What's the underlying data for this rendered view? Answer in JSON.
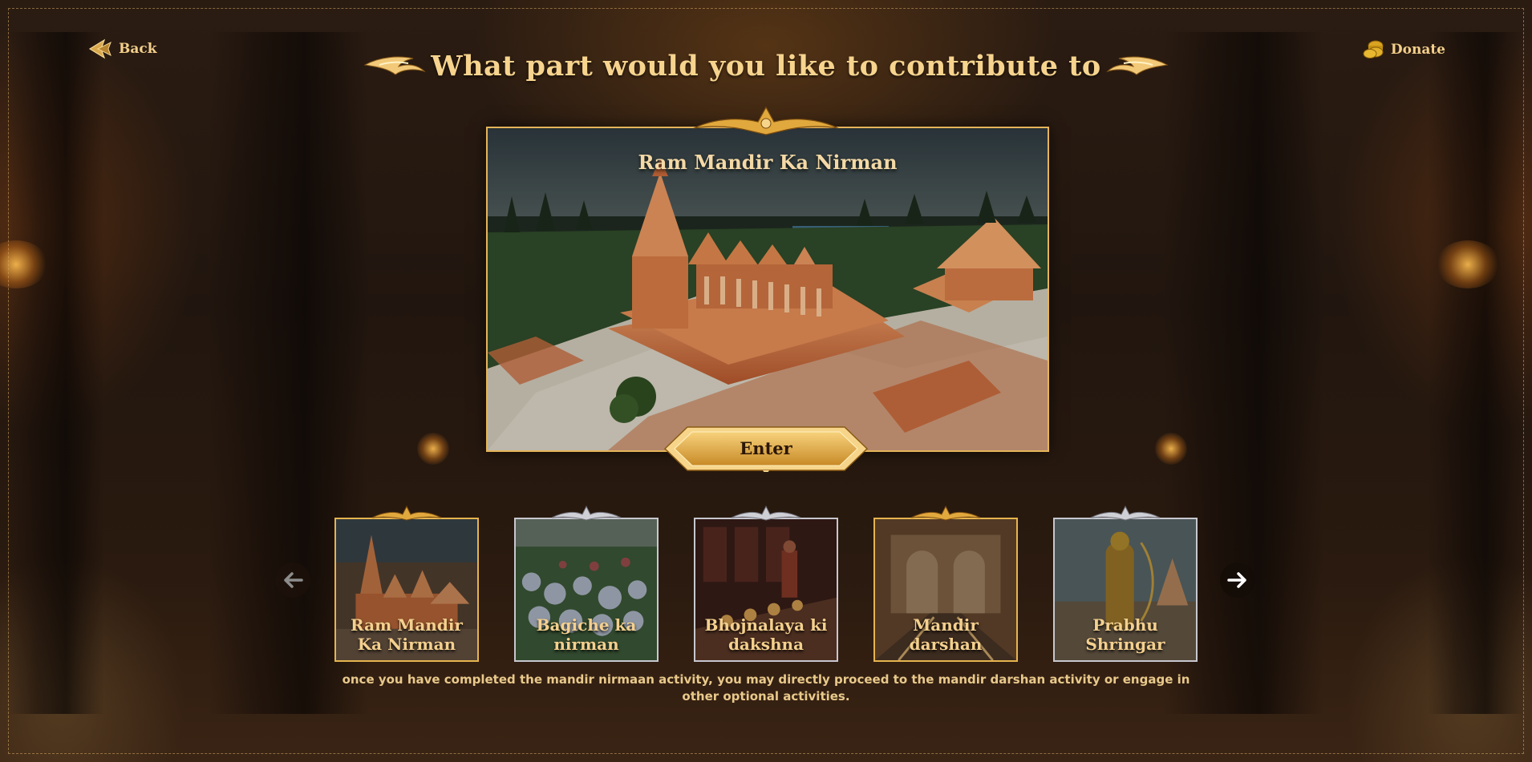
{
  "nav": {
    "back_label": "Back",
    "donate_label": "Donate"
  },
  "heading": {
    "title": "What part would you like to contribute to"
  },
  "preview": {
    "title": "Ram Mandir Ka Nirman",
    "enter_label": "Enter"
  },
  "carousel": {
    "cards": [
      {
        "label_line1": "Ram Mandir",
        "label_line2": "Ka Nirman",
        "selected": true
      },
      {
        "label_line1": "Bagiche ka",
        "label_line2": "nirman",
        "selected": false
      },
      {
        "label_line1": "Bhojnalaya ki",
        "label_line2": "dakshna",
        "selected": false
      },
      {
        "label_line1": "Mandir",
        "label_line2": "darshan",
        "selected": false
      },
      {
        "label_line1": "Prabhu",
        "label_line2": "Shringar",
        "selected": false
      }
    ]
  },
  "footnote": "once you have completed the mandir nirmaan activity, you may directly proceed to the mandir darshan activity or engage in other optional activities.",
  "colors": {
    "gold": "#e6b44f",
    "text_gold": "#f7d48e",
    "silver": "#c7c7cf",
    "bg_dark": "#21160f"
  },
  "icons": {
    "back": "back-arrow-icon",
    "donate": "coins-icon",
    "prev": "arrow-left-icon",
    "next": "arrow-right-icon"
  }
}
